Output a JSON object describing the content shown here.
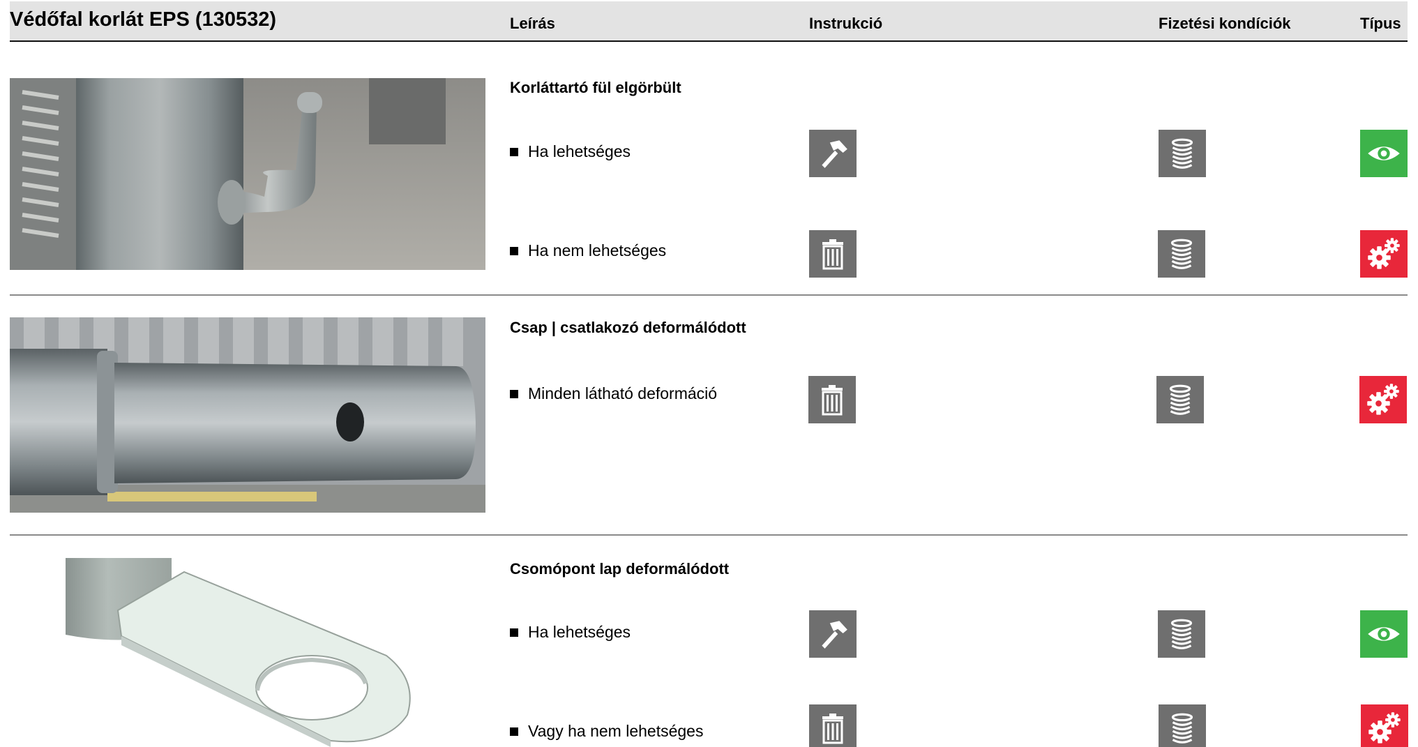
{
  "header": {
    "title": "Védőfal korlát EPS (130532)",
    "columns": {
      "description": "Leírás",
      "instruction": "Instrukció",
      "payment": "Fizetési kondíciók",
      "type": "Típus"
    }
  },
  "sections": [
    {
      "title": "Korláttartó fül elgörbült",
      "items": [
        {
          "label": "Ha lehetséges",
          "instruction_icon": "hammer-icon",
          "payment_icon": "coin-stack-icon",
          "type_icon": "eye-icon",
          "type_color": "#3db34a"
        },
        {
          "label": "Ha nem lehetséges",
          "instruction_icon": "trash-icon",
          "payment_icon": "coin-stack-icon",
          "type_icon": "gears-icon",
          "type_color": "#e8273a"
        }
      ]
    },
    {
      "title": "Csap | csatlakozó deformálódott",
      "items": [
        {
          "label": "Minden látható deformáció",
          "instruction_icon": "trash-icon",
          "payment_icon": "coin-stack-icon",
          "type_icon": "gears-icon",
          "type_color": "#e8273a"
        }
      ]
    },
    {
      "title": "Csomópont lap deformálódott",
      "items": [
        {
          "label": "Ha lehetséges",
          "instruction_icon": "hammer-icon",
          "payment_icon": "coin-stack-icon",
          "type_icon": "eye-icon",
          "type_color": "#3db34a"
        },
        {
          "label": "Vagy ha nem lehetséges",
          "instruction_icon": "trash-icon",
          "payment_icon": "coin-stack-icon",
          "type_icon": "gears-icon",
          "type_color": "#e8273a"
        }
      ]
    }
  ],
  "colors": {
    "icon_gray": "#6f6f6f",
    "green": "#3db34a",
    "red": "#e8273a",
    "header_bg": "#e3e3e3"
  }
}
